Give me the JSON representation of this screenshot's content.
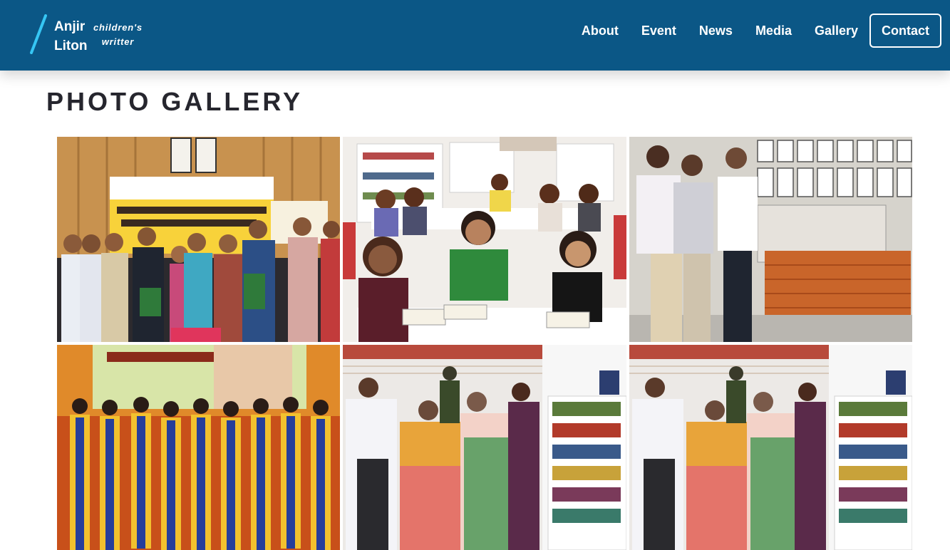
{
  "brand": {
    "name_line1": "Anjir",
    "name_line2": "Liton",
    "tag_line1": "children's",
    "tag_line2": "writter"
  },
  "nav": {
    "items": [
      "About",
      "Event",
      "News",
      "Media",
      "Gallery"
    ],
    "contact": "Contact"
  },
  "page": {
    "title": "PHOTO GALLERY"
  },
  "colors": {
    "header": "#0b5786",
    "accent": "#36c6f4",
    "title": "#26262e"
  },
  "gallery": {
    "photos": [
      "mou-signing-ceremony-photo",
      "children-reading-library-photo",
      "museum-visit-photo",
      "children-stage-performance-photo",
      "library-inauguration-visit-photo",
      "library-inauguration-visit-photo-2"
    ]
  }
}
